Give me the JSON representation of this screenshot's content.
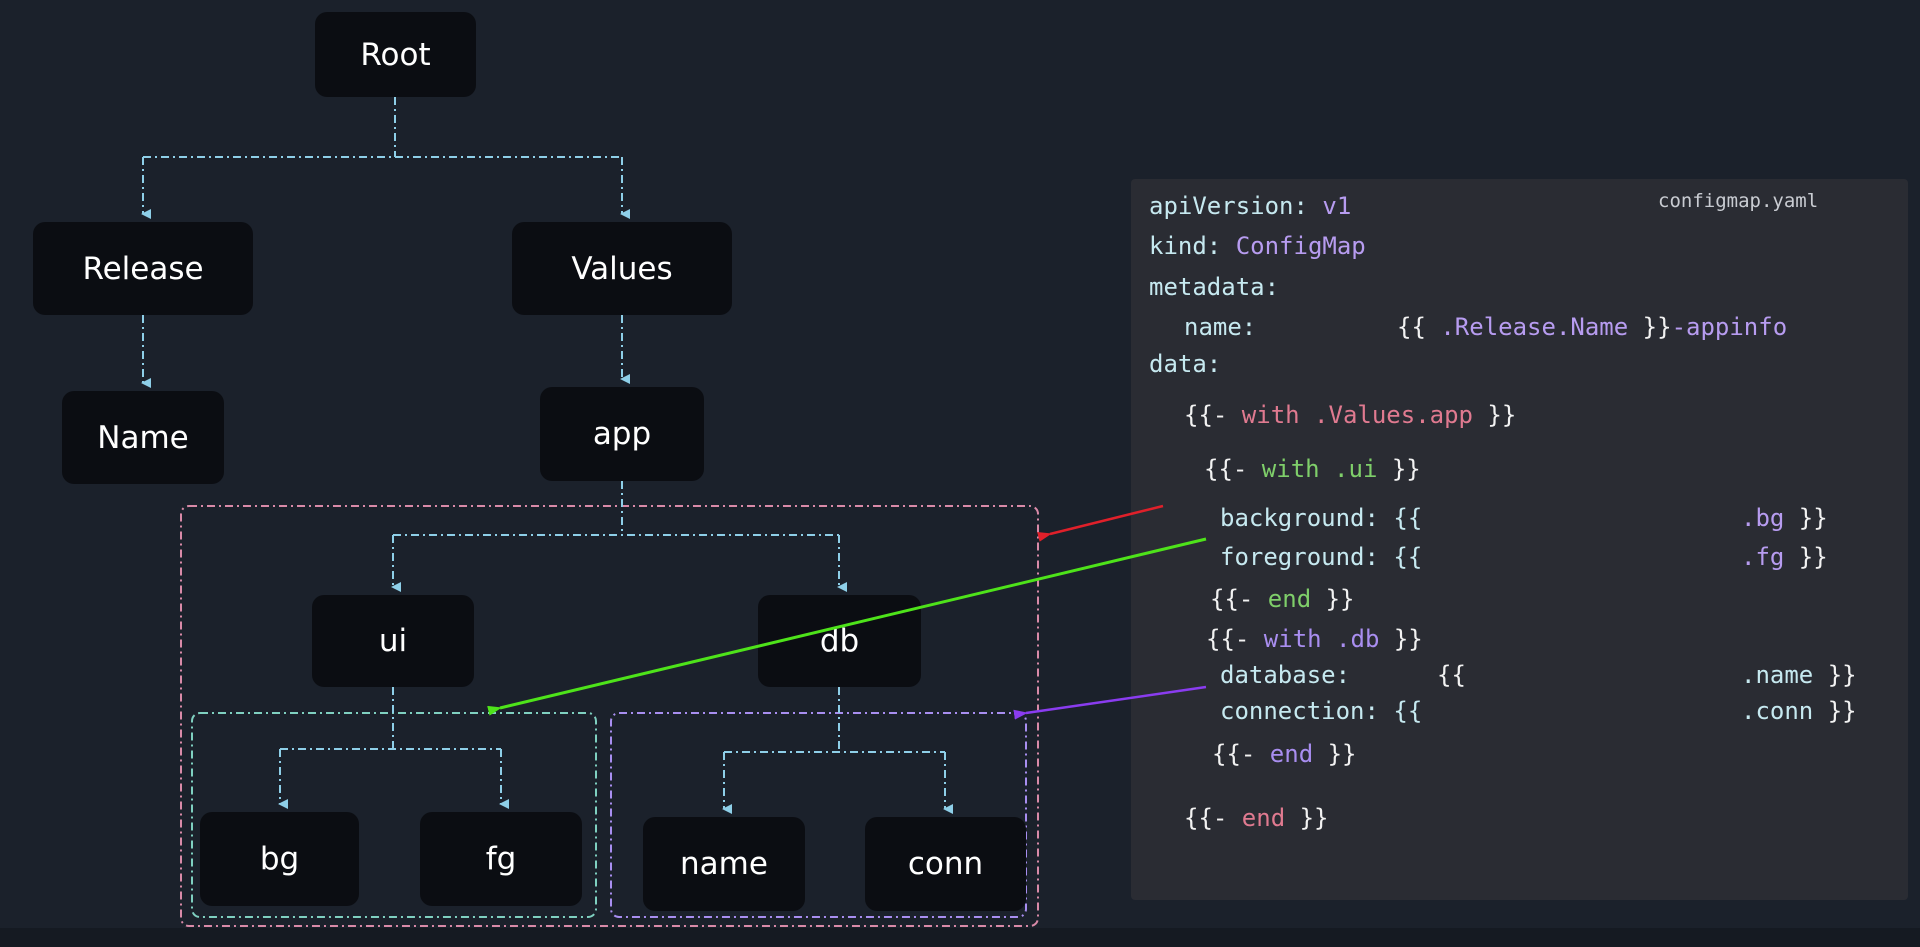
{
  "tree": {
    "nodes": {
      "root": "Root",
      "release": "Release",
      "values": "Values",
      "name": "Name",
      "app": "app",
      "ui": "ui",
      "db": "db",
      "bg": "bg",
      "fg": "fg",
      "db_name": "name",
      "conn": "conn"
    }
  },
  "colors": {
    "edge": "#8ecfe8",
    "group_app": "#d98aa8",
    "group_ui": "#7fd0c0",
    "group_db": "#a88ef0",
    "arrow_red": "#e0202a",
    "arrow_green": "#4ee31a",
    "arrow_purple": "#8a3cf0"
  },
  "code_panel": {
    "filename": "configmap.yaml",
    "lines": [
      [
        {
          "t": "apiVersion: ",
          "c": "k"
        },
        {
          "t": "v1",
          "c": "p"
        }
      ],
      [
        {
          "t": "kind: ",
          "c": "k"
        },
        {
          "t": "ConfigMap",
          "c": "p"
        }
      ],
      [
        {
          "t": "metadata:",
          "c": "k"
        }
      ],
      [
        {
          "t": "name:",
          "c": "k"
        }
      ],
      [
        {
          "t": "{{ ",
          "c": "w"
        },
        {
          "t": ".Release.Name",
          "c": "p"
        },
        {
          "t": " }}",
          "c": "w"
        },
        {
          "t": "-appinfo",
          "c": "p"
        }
      ],
      [
        {
          "t": "data:",
          "c": "k"
        }
      ],
      [
        {
          "t": "{{- ",
          "c": "w"
        },
        {
          "t": "with .Values.app",
          "c": "r"
        },
        {
          "t": " }}",
          "c": "w"
        }
      ],
      [
        {
          "t": "{{- ",
          "c": "w"
        },
        {
          "t": "with .ui",
          "c": "g"
        },
        {
          "t": " }}",
          "c": "w"
        }
      ],
      [
        {
          "t": "background: {{",
          "c": "k"
        }
      ],
      [
        {
          "t": ".bg",
          "c": "p"
        },
        {
          "t": " }}",
          "c": "w"
        }
      ],
      [
        {
          "t": "foreground: {{",
          "c": "k"
        }
      ],
      [
        {
          "t": ".fg",
          "c": "p"
        },
        {
          "t": " }}",
          "c": "w"
        }
      ],
      [
        {
          "t": "{{- ",
          "c": "w"
        },
        {
          "t": "end",
          "c": "g"
        },
        {
          "t": " }}",
          "c": "w"
        }
      ],
      [
        {
          "t": "{{- ",
          "c": "w"
        },
        {
          "t": "with .db",
          "c": "pr"
        },
        {
          "t": " }}",
          "c": "w"
        }
      ],
      [
        {
          "t": "database:",
          "c": "k"
        }
      ],
      [
        {
          "t": "{{",
          "c": "w"
        }
      ],
      [
        {
          "t": ".name",
          "c": "k"
        },
        {
          "t": " }}",
          "c": "w"
        }
      ],
      [
        {
          "t": "connection: {{",
          "c": "k"
        }
      ],
      [
        {
          "t": ".conn",
          "c": "k"
        },
        {
          "t": " }}",
          "c": "w"
        }
      ],
      [
        {
          "t": "{{- ",
          "c": "w"
        },
        {
          "t": "end",
          "c": "pr"
        },
        {
          "t": " }}",
          "c": "w"
        }
      ],
      [
        {
          "t": "{{- ",
          "c": "w"
        },
        {
          "t": "end",
          "c": "r"
        },
        {
          "t": " }}",
          "c": "w"
        }
      ]
    ]
  }
}
